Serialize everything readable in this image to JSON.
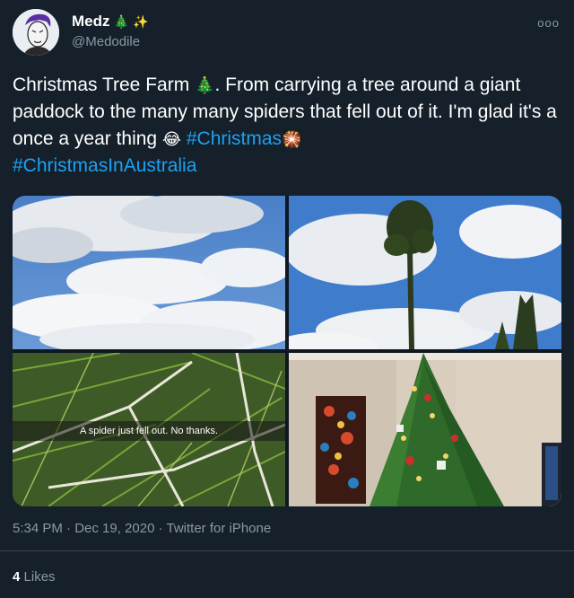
{
  "tweet": {
    "display_name": "Medz",
    "name_emoji_1": "🎄",
    "name_emoji_2": "✨",
    "handle": "@Medodile",
    "more_label": "ooo",
    "text_part1": "Christmas Tree Farm",
    "text_emoji_tree": "🎄",
    "text_part2": ". From carrying a tree around a giant paddock to the many many spiders that fell out of it. I'm glad it's a once a year thing",
    "text_emoji_laugh": "😂",
    "hashtag1": "#Christmas",
    "text_emoji_sparkle": "🎇",
    "hashtag2": "#ChristmasInAustralia",
    "timestamp": "5:34 PM · Dec 19, 2020 · Twitter for iPhone",
    "likes_count": "4",
    "likes_label": "Likes"
  },
  "media": {
    "caption": "A spider just fell out. No thanks."
  },
  "colors": {
    "background": "#15202b",
    "link": "#1da1f2",
    "secondary_text": "#8899a6",
    "divider": "#38444d"
  }
}
